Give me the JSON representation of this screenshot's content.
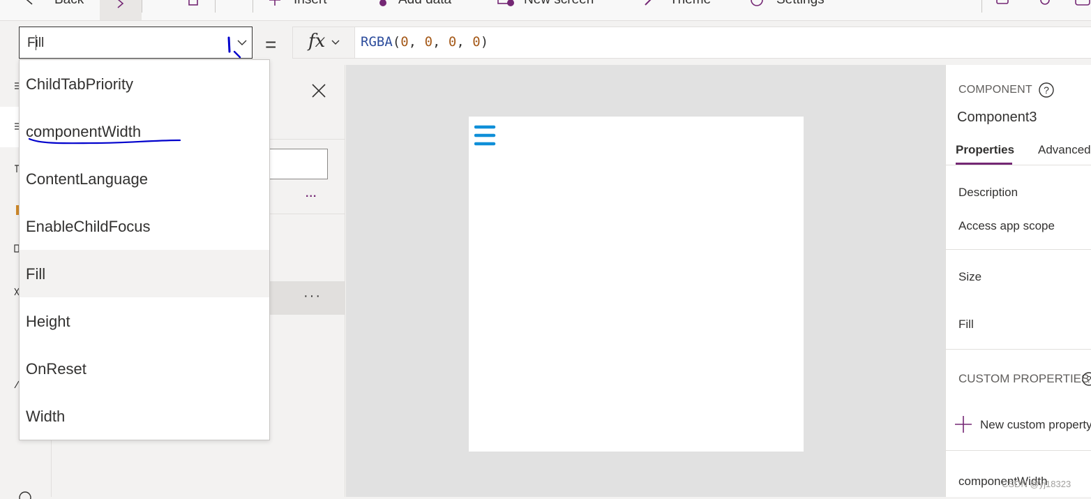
{
  "toolbar": {
    "back": "Back",
    "insert": "Insert",
    "add_data": "Add data",
    "new_screen": "New screen",
    "theme": "Theme",
    "settings": "Settings"
  },
  "formula_bar": {
    "property": "Fill",
    "equals": "=",
    "fx": "fx",
    "formula": {
      "fn": "RGBA",
      "open": "(",
      "args": [
        "0",
        "0",
        "0",
        "0"
      ],
      "sep": ", ",
      "close": ")"
    }
  },
  "property_dropdown": {
    "items": [
      "ChildTabPriority",
      "componentWidth",
      "ContentLanguage",
      "EnableChildFocus",
      "Fill",
      "Height",
      "OnReset",
      "Width"
    ],
    "selected_index": 4
  },
  "tree_panel": {
    "more_label": "...",
    "row_more_label": "···"
  },
  "properties_panel": {
    "section_label": "COMPONENT",
    "component_name": "Component3",
    "tabs": [
      {
        "label": "Properties",
        "active": true
      },
      {
        "label": "Advanced",
        "active": false
      }
    ],
    "rows": {
      "description": "Description",
      "access_app_scope": "Access app scope",
      "size": "Size",
      "fill": "Fill"
    },
    "custom_properties_label": "CUSTOM PROPERTIES",
    "new_custom_property": "New custom property",
    "custom_items": [
      "componentWidth"
    ]
  },
  "watermark": "CSDN @yj18323",
  "colors": {
    "accent": "#742774",
    "hamburger": "#0f8fd8",
    "annotation": "#0000cc"
  }
}
